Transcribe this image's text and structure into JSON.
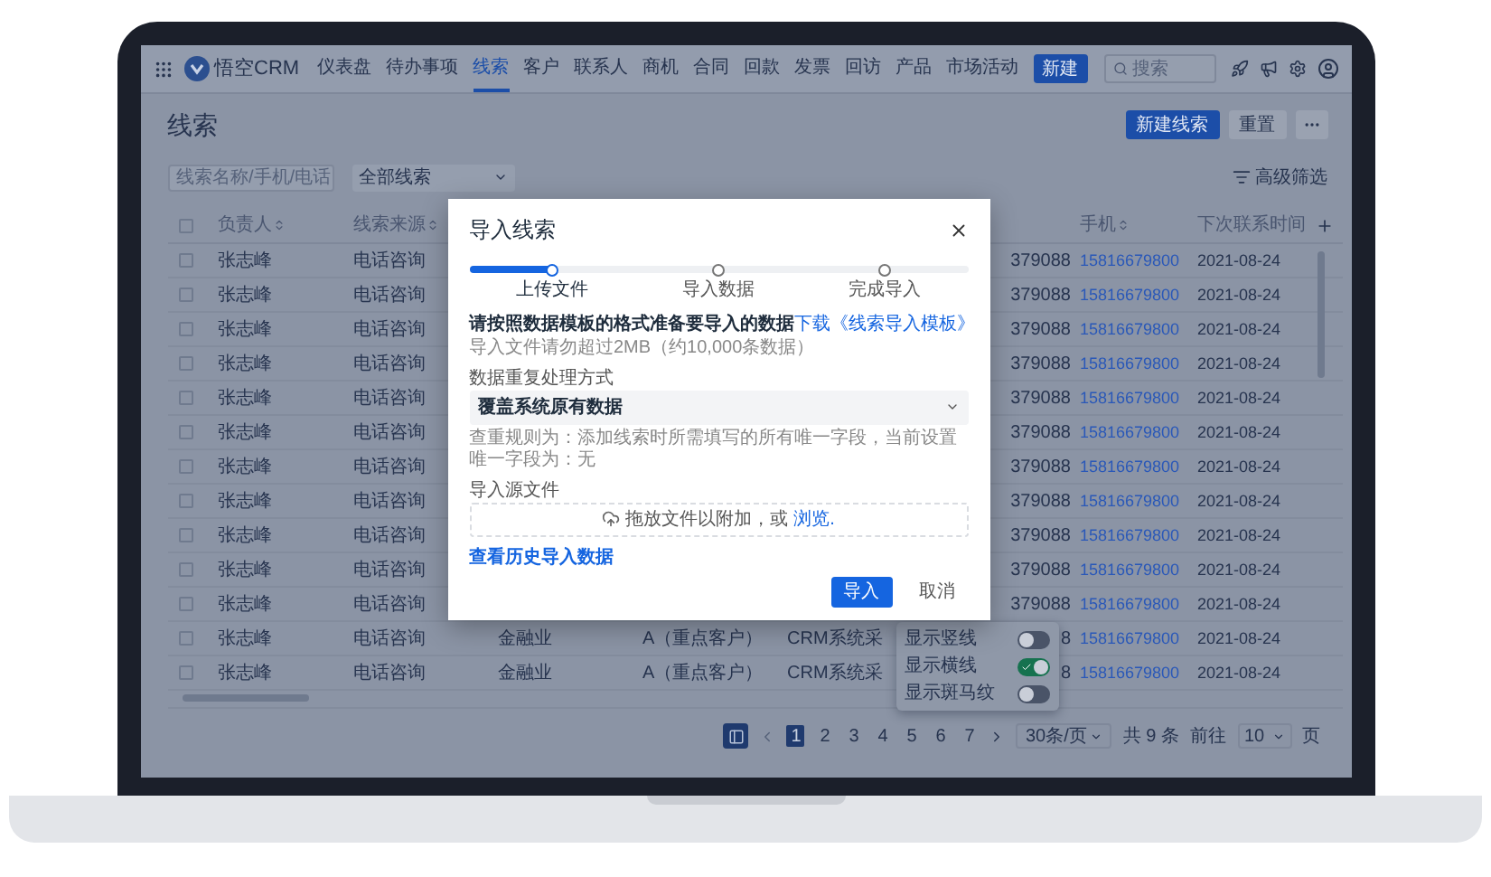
{
  "nav": {
    "app_name": "悟空CRM",
    "items": [
      {
        "label": "仪表盘",
        "selected": false
      },
      {
        "label": "待办事项",
        "selected": false
      },
      {
        "label": "线索",
        "selected": true
      },
      {
        "label": "客户",
        "selected": false
      },
      {
        "label": "联系人",
        "selected": false
      },
      {
        "label": "商机",
        "selected": false
      },
      {
        "label": "合同",
        "selected": false
      },
      {
        "label": "回款",
        "selected": false
      },
      {
        "label": "发票",
        "selected": false
      },
      {
        "label": "回访",
        "selected": false
      },
      {
        "label": "产品",
        "selected": false
      },
      {
        "label": "市场活动",
        "selected": false
      }
    ],
    "new_button": "新建",
    "search": {
      "placeholder": "搜索"
    }
  },
  "page": {
    "title": "线索",
    "buttons": [
      {
        "label": "新建线索",
        "kind": "primary"
      },
      {
        "label": "重置",
        "kind": "plain"
      }
    ]
  },
  "filters": {
    "search": {
      "placeholder": "线索名称/手机/电话"
    },
    "scope_select": "全部线索",
    "advanced_filter": "高级筛选"
  },
  "table": {
    "header_checked": false,
    "headers": {
      "owner": "负责人",
      "source": "线索来源",
      "mobile": "手机",
      "next_contact": "下次联系时间"
    },
    "rows": [
      {
        "checked": false,
        "owner": "张志峰",
        "source": "电话咨询",
        "telephone": "379088",
        "mobile": "15816679800",
        "next_contact": "2021-08-24"
      },
      {
        "checked": false,
        "owner": "张志峰",
        "source": "电话咨询",
        "telephone": "379088",
        "mobile": "15816679800",
        "next_contact": "2021-08-24"
      },
      {
        "checked": false,
        "owner": "张志峰",
        "source": "电话咨询",
        "telephone": "379088",
        "mobile": "15816679800",
        "next_contact": "2021-08-24"
      },
      {
        "checked": false,
        "owner": "张志峰",
        "source": "电话咨询",
        "telephone": "379088",
        "mobile": "15816679800",
        "next_contact": "2021-08-24"
      },
      {
        "checked": false,
        "owner": "张志峰",
        "source": "电话咨询",
        "telephone": "379088",
        "mobile": "15816679800",
        "next_contact": "2021-08-24"
      },
      {
        "checked": false,
        "owner": "张志峰",
        "source": "电话咨询",
        "telephone": "379088",
        "mobile": "15816679800",
        "next_contact": "2021-08-24"
      },
      {
        "checked": false,
        "owner": "张志峰",
        "source": "电话咨询",
        "telephone": "379088",
        "mobile": "15816679800",
        "next_contact": "2021-08-24"
      },
      {
        "checked": false,
        "owner": "张志峰",
        "source": "电话咨询",
        "telephone": "379088",
        "mobile": "15816679800",
        "next_contact": "2021-08-24"
      },
      {
        "checked": false,
        "owner": "张志峰",
        "source": "电话咨询",
        "telephone": "379088",
        "mobile": "15816679800",
        "next_contact": "2021-08-24"
      },
      {
        "checked": false,
        "owner": "张志峰",
        "source": "电话咨询",
        "telephone": "379088",
        "mobile": "15816679800",
        "next_contact": "2021-08-24"
      },
      {
        "checked": false,
        "owner": "张志峰",
        "source": "电话咨询",
        "telephone": "379088",
        "mobile": "15816679800",
        "next_contact": "2021-08-24"
      },
      {
        "checked": false,
        "owner": "张志峰",
        "source": "电话咨询",
        "industry": "金融业",
        "level": "A（重点客户）",
        "system": "CRM系统采",
        "telephone": "8",
        "mobile": "15816679800",
        "next_contact": "2021-08-24"
      },
      {
        "checked": false,
        "owner": "张志峰",
        "source": "电话咨询",
        "industry": "金融业",
        "level": "A（重点客户）",
        "system": "CRM系统采",
        "telephone": "8",
        "mobile": "15816679800",
        "next_contact": "2021-08-24"
      }
    ]
  },
  "display_menu": {
    "items": [
      {
        "label": "显示竖线",
        "on": false
      },
      {
        "label": "显示横线",
        "on": true
      },
      {
        "label": "显示斑马纹",
        "on": false
      }
    ]
  },
  "pagination": {
    "pages": [
      {
        "label": "1",
        "selected": true
      },
      {
        "label": "2",
        "selected": false
      },
      {
        "label": "3",
        "selected": false
      },
      {
        "label": "4",
        "selected": false
      },
      {
        "label": "5",
        "selected": false
      },
      {
        "label": "6",
        "selected": false
      },
      {
        "label": "7",
        "selected": false
      }
    ],
    "page_size": "30条/页",
    "total": "共 9 条",
    "goto_label": "前往",
    "goto_value": "10",
    "page_suffix": "页"
  },
  "modal": {
    "title": "导入线索",
    "steps": [
      {
        "label": "上传文件",
        "selected": true
      },
      {
        "label": "导入数据",
        "selected": false
      },
      {
        "label": "完成导入",
        "selected": false
      }
    ],
    "progress": {
      "level": 0.17
    },
    "heading": "请按照数据模板的格式准备要导入的数据",
    "template_link": "下载《线索导入模板》",
    "size_hint": "导入文件请勿超过2MB（约10,000条数据）",
    "dedupe_label": "数据重复处理方式",
    "dedupe_select": "覆盖系统原有数据",
    "dedupe_hint": "查重规则为：添加线索时所需填写的所有唯一字段，当前设置唯一字段为：无",
    "file_label": "导入源文件",
    "dropzone": {
      "text": "拖放文件以附加，或",
      "link": "浏览."
    },
    "history_link": "查看历史导入数据",
    "buttons": [
      {
        "label": "导入",
        "kind": "primary"
      },
      {
        "label": "取消",
        "kind": "plain"
      }
    ]
  }
}
